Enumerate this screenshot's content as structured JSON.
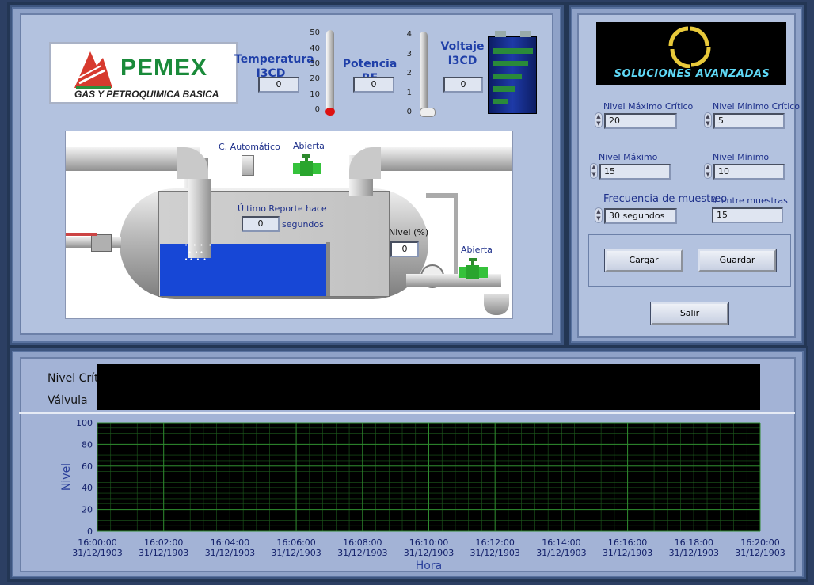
{
  "logo": {
    "brand": "PEMEX",
    "subtitle": "GAS Y PETROQUIMICA BASICA"
  },
  "company": {
    "name": "SOLUCIONES AVANZADAS"
  },
  "temperatura": {
    "title": "Temperatura I3CD",
    "value": "0",
    "scale": [
      "50",
      "40",
      "30",
      "20",
      "10",
      "0"
    ]
  },
  "potencia": {
    "title": "Potencia RF",
    "value": "0",
    "scale": [
      "4",
      "3",
      "2",
      "1",
      "0"
    ]
  },
  "voltaje": {
    "title": "Voltaje I3CD",
    "value": "0"
  },
  "tank": {
    "auto_label": "C. Automático",
    "valve1_label": "Abierta",
    "valve2_label": "Abierta",
    "report_label": "Último Reporte hace",
    "report_value": "0",
    "report_unit": "segundos",
    "level_label": "Nivel (%)",
    "level_value": "0",
    "fill_level": 0.5
  },
  "settings": {
    "max_critico_label": "Nivel Máximo Crítico",
    "max_critico_value": "20",
    "min_critico_label": "Nivel Mínimo Crítico",
    "min_critico_value": "5",
    "max_label": "Nivel Máximo",
    "max_value": "15",
    "min_label": "Nivel Mínimo",
    "min_value": "10",
    "freq_label": "Frecuencia de muestreo",
    "freq_value": "30 segundos",
    "entre_label": "# entre muestras",
    "entre_value": "15",
    "cargar": "Cargar",
    "guardar": "Guardar",
    "salir": "Salir"
  },
  "digital": {
    "row1": "Nivel Crítico",
    "row2": "Válvula"
  },
  "chart_data": {
    "type": "line",
    "xlabel": "Hora",
    "ylabel": "Nivel",
    "ylim": [
      0,
      100
    ],
    "yticks": [
      "100",
      "80",
      "60",
      "40",
      "20",
      "0"
    ],
    "xticks": [
      {
        "time": "16:00:00",
        "date": "31/12/1903"
      },
      {
        "time": "16:02:00",
        "date": "31/12/1903"
      },
      {
        "time": "16:04:00",
        "date": "31/12/1903"
      },
      {
        "time": "16:06:00",
        "date": "31/12/1903"
      },
      {
        "time": "16:08:00",
        "date": "31/12/1903"
      },
      {
        "time": "16:10:00",
        "date": "31/12/1903"
      },
      {
        "time": "16:12:00",
        "date": "31/12/1903"
      },
      {
        "time": "16:14:00",
        "date": "31/12/1903"
      },
      {
        "time": "16:16:00",
        "date": "31/12/1903"
      },
      {
        "time": "16:18:00",
        "date": "31/12/1903"
      },
      {
        "time": "16:20:00",
        "date": "31/12/1903"
      }
    ],
    "grid": true,
    "series": []
  },
  "colors": {
    "plot_bg": "#000000",
    "grid": "#2f8a2f",
    "water": "#1747d6",
    "panel": "#8fa2c8"
  }
}
